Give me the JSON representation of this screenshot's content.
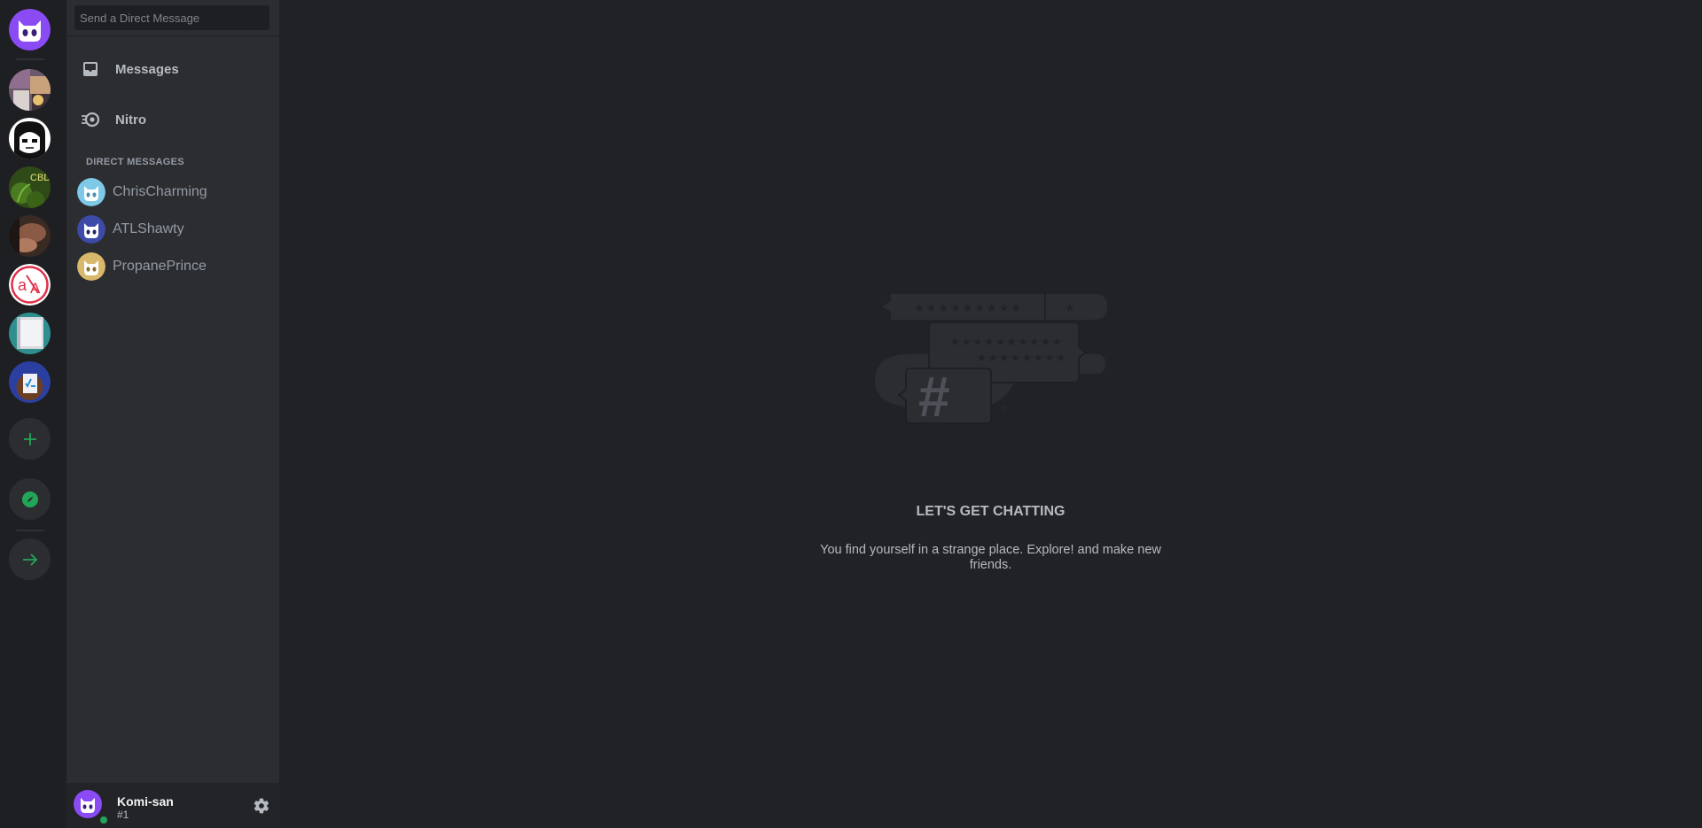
{
  "search": {
    "placeholder": "Send a Direct Message"
  },
  "nav": [
    {
      "label": "Messages",
      "icon": "inbox-icon"
    },
    {
      "label": "Nitro",
      "icon": "nitro-icon"
    }
  ],
  "direct_messages": {
    "header": "DIRECT MESSAGES",
    "items": [
      {
        "name": "ChrisCharming",
        "avatar_color": "#7fc9e8"
      },
      {
        "name": "ATLShawty",
        "avatar_color": "#3d4aa8"
      },
      {
        "name": "PropanePrince",
        "avatar_color": "#d8b86a"
      }
    ]
  },
  "servers": [
    {
      "name": "server-1",
      "icon": "home-logo-icon"
    },
    {
      "name": "server-2",
      "icon": "photo-collage-icon"
    },
    {
      "name": "server-3",
      "icon": "manga-portrait-icon"
    },
    {
      "name": "server-4",
      "icon": "cbd-leaf-icon"
    },
    {
      "name": "server-5",
      "icon": "hand-photo-icon"
    },
    {
      "name": "server-6",
      "icon": "aa-logo-icon"
    },
    {
      "name": "server-7",
      "icon": "book-icon"
    },
    {
      "name": "server-8",
      "icon": "checklist-bear-icon"
    }
  ],
  "rail_actions": [
    {
      "icon": "plus-icon",
      "color": "#23a559"
    },
    {
      "icon": "compass-icon",
      "color": "#23a559"
    },
    {
      "icon": "arrow-right-icon",
      "color": "#23a559"
    }
  ],
  "user": {
    "name": "Komi-san",
    "discriminator": "#1",
    "status_color": "#23a559"
  },
  "empty_state": {
    "title": "LET'S GET CHATTING",
    "text": "You find yourself in a strange place. Explore! and make new friends."
  },
  "colors": {
    "accent": "#7c4dff",
    "online": "#23a559"
  }
}
